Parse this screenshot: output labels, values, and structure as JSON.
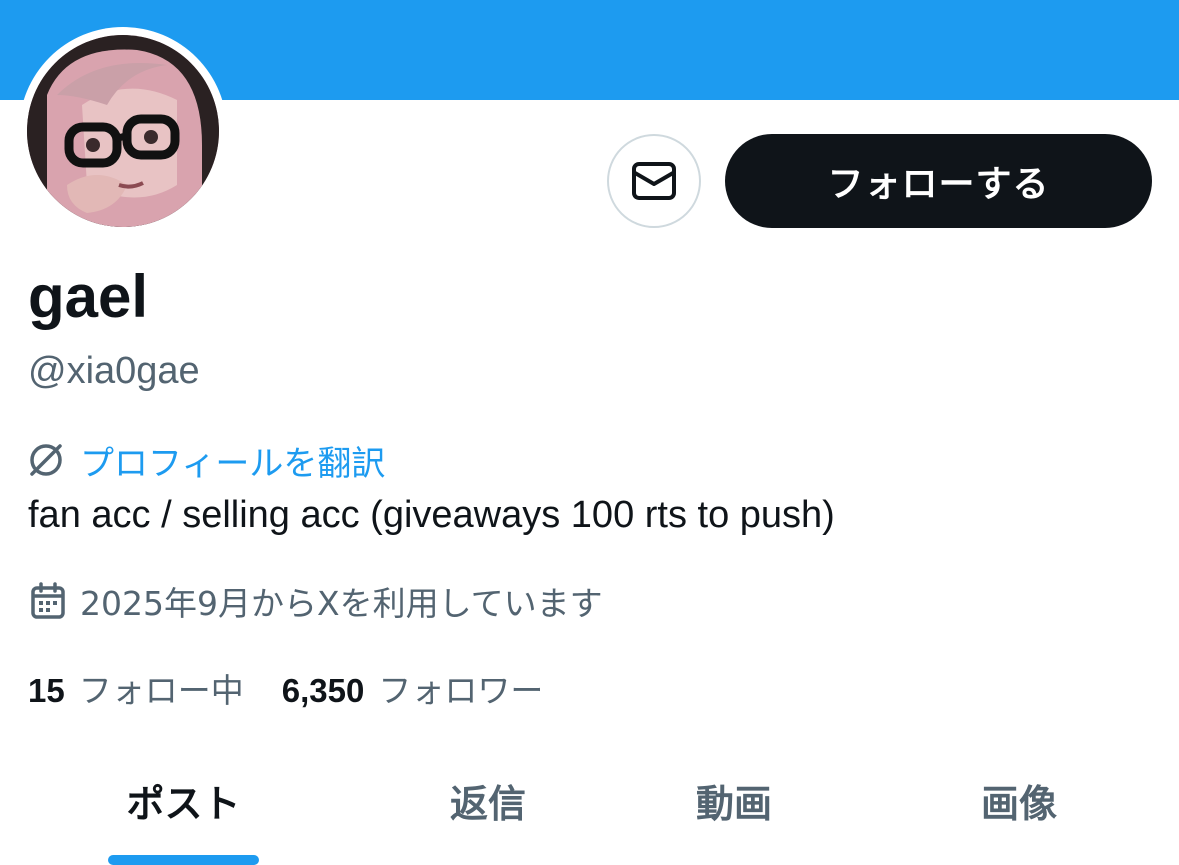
{
  "profile": {
    "display_name": "gael",
    "handle": "@xia0gae",
    "translate_label": "プロフィールを翻訳",
    "bio": "fan acc / selling acc (giveaways 100 rts to push)",
    "joined": "2025年9月からXを利用しています"
  },
  "actions": {
    "follow_label": "フォローする",
    "message_icon": "envelope-icon"
  },
  "stats": {
    "following_count": "15",
    "following_label": "フォロー中",
    "followers_count": "6,350",
    "followers_label": "フォロワー"
  },
  "tabs": [
    {
      "label": "ポスト",
      "active": true
    },
    {
      "label": "返信",
      "active": false
    },
    {
      "label": "動画",
      "active": false
    },
    {
      "label": "画像",
      "active": false
    }
  ],
  "colors": {
    "banner": "#1d9bf0",
    "accent": "#1d9bf0",
    "text_primary": "#0f1419",
    "text_secondary": "#536471"
  },
  "icons": {
    "translate": "globe-translate-icon",
    "calendar": "calendar-icon"
  }
}
